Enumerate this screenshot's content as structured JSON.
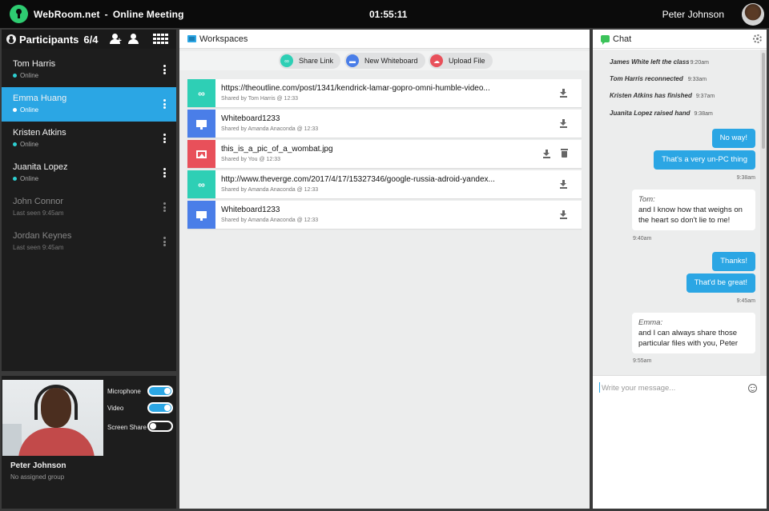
{
  "app": {
    "brand": "WebRoom.net",
    "separator": "-",
    "meeting_title": "Online Meeting",
    "clock": "01:55:11",
    "user_name": "Peter Johnson"
  },
  "participants": {
    "title": "Participants",
    "count": "6/4",
    "items": [
      {
        "name": "Tom Harris",
        "status": "Online"
      },
      {
        "name": "Emma Huang",
        "status": "Online"
      },
      {
        "name": "Kristen Atkins",
        "status": "Online"
      },
      {
        "name": "Juanita Lopez",
        "status": "Online"
      },
      {
        "name": "John Connor",
        "status": "Last seen 9:45am"
      },
      {
        "name": "Jordan Keynes",
        "status": "Last seen 9:45am"
      }
    ]
  },
  "self_panel": {
    "name": "Peter Johnson",
    "group": "No assigned group",
    "controls": [
      {
        "label": "Microphone",
        "on": true
      },
      {
        "label": "Video",
        "on": true
      },
      {
        "label": "Screen Share",
        "on": false
      }
    ]
  },
  "workspaces": {
    "title": "Workspaces",
    "toolbar": {
      "share_link": "Share Link",
      "new_whiteboard": "New Whiteboard",
      "upload_file": "Upload File"
    },
    "files": [
      {
        "type": "link",
        "name": "https://theoutline.com/post/1341/kendrick-lamar-gopro-omni-humble-video...",
        "shared_by": "Shared by Tom Harris @ 12:33"
      },
      {
        "type": "whiteboard",
        "name": "Whiteboard1233",
        "shared_by": "Shared by Amanda Anaconda @ 12:33"
      },
      {
        "type": "image",
        "name": "this_is_a_pic_of_a_wombat.jpg",
        "shared_by": "Shared by You @ 12:33"
      },
      {
        "type": "link",
        "name": "http://www.theverge.com/2017/4/17/15327346/google-russia-adroid-yandex...",
        "shared_by": "Shared by Amanda Anaconda @ 12:33"
      },
      {
        "type": "whiteboard",
        "name": "Whiteboard1233",
        "shared_by": "Shared by Amanda Anaconda @ 12:33"
      }
    ]
  },
  "chat": {
    "title": "Chat",
    "system": [
      {
        "text": "James White left the class",
        "time": "9:20am"
      },
      {
        "text": "Tom Harris reconnected",
        "time": "9:33am"
      },
      {
        "text": "Kristen Atkins has finished",
        "time": "9:37am"
      },
      {
        "text": "Juanita Lopez raised hand",
        "time": "9:38am"
      }
    ],
    "messages": {
      "out1a": "No way!",
      "out1b": "That's a very un-PC thing",
      "out1_time": "9:38am",
      "in1_who": "Tom:",
      "in1_text": "and I know how that weighs on the heart so don't lie to me!",
      "in1_time": "9:40am",
      "out2a": "Thanks!",
      "out2b": "That'd be great!",
      "out2_time": "9:45am",
      "in2_who": "Emma:",
      "in2_text": "and I can always share those particular files with you, Peter",
      "in2_time": "9:55am"
    },
    "input_placeholder": "Write your message..."
  },
  "colors": {
    "accent": "#2ba6e4",
    "online": "#2ecfd1",
    "link_file": "#2ecfb5",
    "whiteboard_file": "#4a7ee8",
    "image_file": "#e8505a",
    "brand_logo": "#2ecc71"
  }
}
